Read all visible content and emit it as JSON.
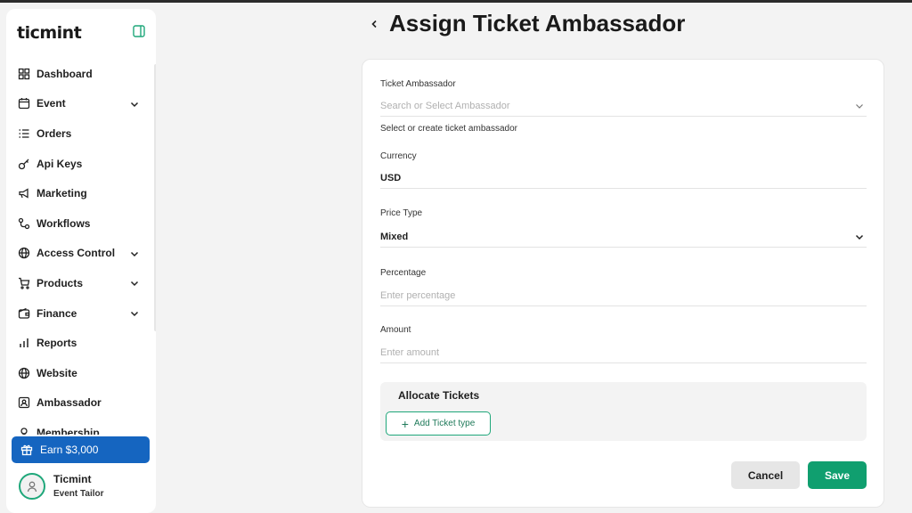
{
  "app": {
    "logo": "ticmint"
  },
  "sidebar": {
    "items": [
      {
        "label": "Dashboard",
        "icon": "dashboard-icon",
        "has_chevron": false
      },
      {
        "label": "Event",
        "icon": "calendar-icon",
        "has_chevron": true
      },
      {
        "label": "Orders",
        "icon": "list-icon",
        "has_chevron": false
      },
      {
        "label": "Api Keys",
        "icon": "key-icon",
        "has_chevron": false
      },
      {
        "label": "Marketing",
        "icon": "megaphone-icon",
        "has_chevron": false
      },
      {
        "label": "Workflows",
        "icon": "workflow-icon",
        "has_chevron": false
      },
      {
        "label": "Access Control",
        "icon": "globe-lock-icon",
        "has_chevron": true
      },
      {
        "label": "Products",
        "icon": "cart-icon",
        "has_chevron": true
      },
      {
        "label": "Finance",
        "icon": "wallet-icon",
        "has_chevron": true
      },
      {
        "label": "Reports",
        "icon": "bar-chart-icon",
        "has_chevron": false
      },
      {
        "label": "Website",
        "icon": "globe-icon",
        "has_chevron": false
      },
      {
        "label": "Ambassador",
        "icon": "id-badge-icon",
        "has_chevron": false
      },
      {
        "label": "Membership",
        "icon": "membership-icon",
        "has_chevron": false
      }
    ],
    "earn_label": "Earn $3,000",
    "user": {
      "name": "Ticmint",
      "subtitle": "Event Tailor"
    }
  },
  "header": {
    "title": "Assign Ticket Ambassador"
  },
  "form": {
    "ambassador": {
      "label": "Ticket Ambassador",
      "placeholder": "Search or Select Ambassador",
      "helper": "Select or create ticket ambassador"
    },
    "currency": {
      "label": "Currency",
      "value": "USD"
    },
    "price_type": {
      "label": "Price Type",
      "value": "Mixed"
    },
    "percentage": {
      "label": "Percentage",
      "placeholder": "Enter percentage"
    },
    "amount": {
      "label": "Amount",
      "placeholder": "Enter amount"
    },
    "allocate": {
      "title": "Allocate Tickets",
      "add_label": "Add Ticket type"
    },
    "actions": {
      "cancel": "Cancel",
      "save": "Save"
    }
  },
  "colors": {
    "accent": "#109f6f",
    "earn": "#1565c0",
    "background": "#f3f3f3"
  }
}
